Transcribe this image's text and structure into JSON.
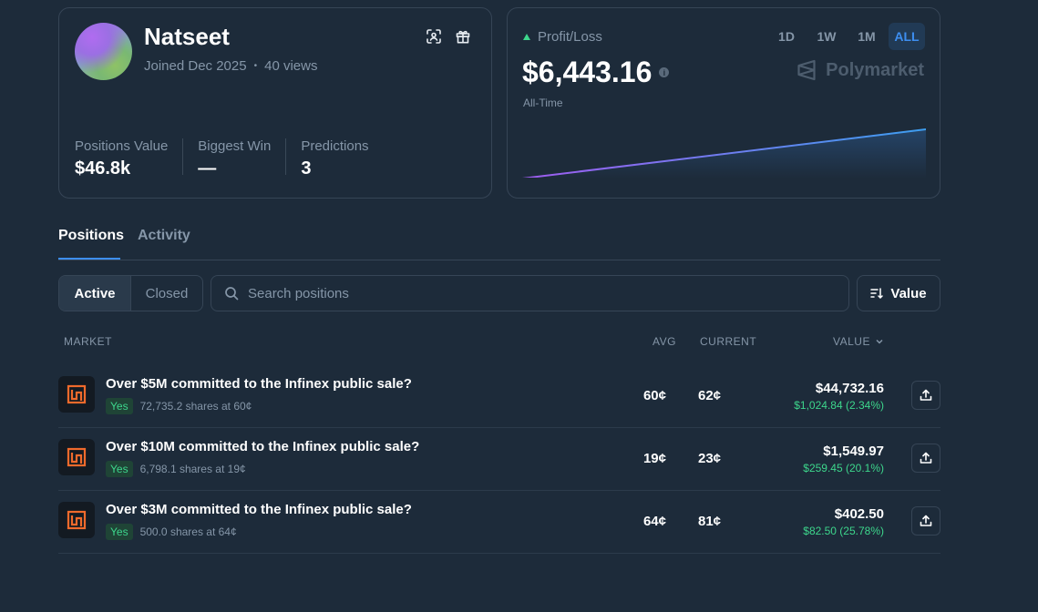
{
  "profile": {
    "username": "Natseet",
    "joined": "Joined Dec 2025",
    "separator": "•",
    "views": "40 views",
    "stats": [
      {
        "label": "Positions Value",
        "value": "$46.8k"
      },
      {
        "label": "Biggest Win",
        "value": "—"
      },
      {
        "label": "Predictions",
        "value": "3"
      }
    ]
  },
  "pnl": {
    "label": "Profit/Loss",
    "value": "$6,443.16",
    "period": "All-Time",
    "ranges": [
      "1D",
      "1W",
      "1M",
      "ALL"
    ],
    "selected_range": "ALL",
    "brand": "Polymarket",
    "trend": "rising"
  },
  "tabs": [
    "Positions",
    "Activity"
  ],
  "filter": {
    "active": "Active",
    "closed": "Closed"
  },
  "search": {
    "placeholder": "Search positions"
  },
  "sort": {
    "label": "Value"
  },
  "table": {
    "headers": {
      "market": "MARKET",
      "avg": "AVG",
      "current": "CURRENT",
      "value": "VALUE"
    },
    "rows": [
      {
        "title": "Over $5M committed to the Infinex public sale?",
        "outcome": "Yes",
        "shares": "72,735.2 shares at 60¢",
        "avg": "60¢",
        "current": "62¢",
        "value": "$44,732.16",
        "pnl": "$1,024.84 (2.34%)"
      },
      {
        "title": "Over $10M committed to the Infinex public sale?",
        "outcome": "Yes",
        "shares": "6,798.1 shares at 19¢",
        "avg": "19¢",
        "current": "23¢",
        "value": "$1,549.97",
        "pnl": "$259.45 (20.1%)"
      },
      {
        "title": "Over $3M committed to the Infinex public sale?",
        "outcome": "Yes",
        "shares": "500.0 shares at 64¢",
        "avg": "64¢",
        "current": "81¢",
        "value": "$402.50",
        "pnl": "$82.50 (25.78%)"
      }
    ]
  },
  "colors": {
    "accent": "#3d8ef0",
    "positive": "#3dd68c",
    "background": "#1d2b3a"
  }
}
